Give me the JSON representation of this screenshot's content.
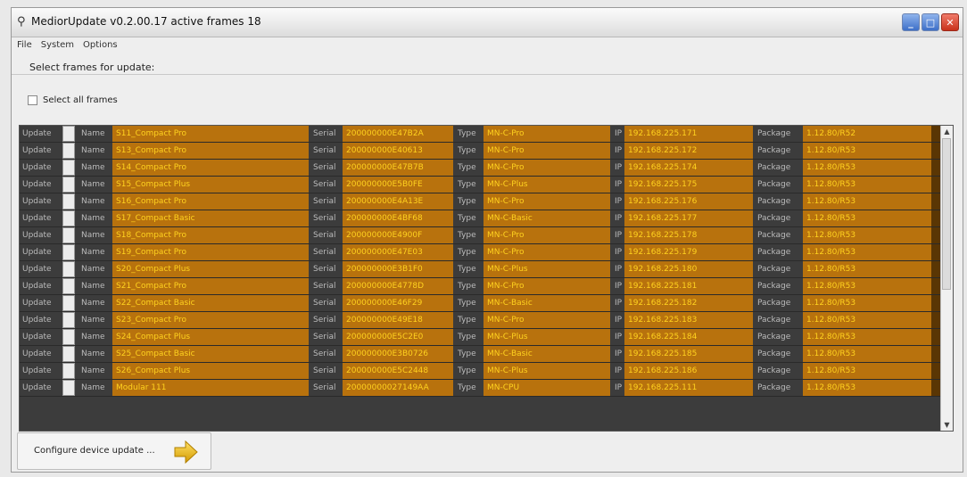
{
  "window": {
    "title": "MediorUpdate  v0.2.00.17    active frames  18",
    "app_icon": "app-icon"
  },
  "menu": [
    "File",
    "System",
    "Options"
  ],
  "section_title": "Select frames for update:",
  "select_all_label": "Select all frames",
  "row_labels": {
    "update": "Update",
    "name": "Name",
    "serial": "Serial",
    "type": "Type",
    "ip": "IP",
    "package": "Package"
  },
  "frames": [
    {
      "name": "S11_Compact Pro",
      "serial": "200000000E47B2A",
      "type": "MN-C-Pro",
      "ip": "192.168.225.171",
      "package": "1.12.80/R52"
    },
    {
      "name": "S13_Compact Pro",
      "serial": "200000000E40613",
      "type": "MN-C-Pro",
      "ip": "192.168.225.172",
      "package": "1.12.80/R53"
    },
    {
      "name": "S14_Compact Pro",
      "serial": "200000000E47B7B",
      "type": "MN-C-Pro",
      "ip": "192.168.225.174",
      "package": "1.12.80/R53"
    },
    {
      "name": "S15_Compact Plus",
      "serial": "200000000E5B0FE",
      "type": "MN-C-Plus",
      "ip": "192.168.225.175",
      "package": "1.12.80/R53"
    },
    {
      "name": "S16_Compact Pro",
      "serial": "200000000E4A13E",
      "type": "MN-C-Pro",
      "ip": "192.168.225.176",
      "package": "1.12.80/R53"
    },
    {
      "name": "S17_Compact Basic",
      "serial": "200000000E4BF68",
      "type": "MN-C-Basic",
      "ip": "192.168.225.177",
      "package": "1.12.80/R53"
    },
    {
      "name": "S18_Compact Pro",
      "serial": "200000000E4900F",
      "type": "MN-C-Pro",
      "ip": "192.168.225.178",
      "package": "1.12.80/R53"
    },
    {
      "name": "S19_Compact Pro",
      "serial": "200000000E47E03",
      "type": "MN-C-Pro",
      "ip": "192.168.225.179",
      "package": "1.12.80/R53"
    },
    {
      "name": "S20_Compact Plus",
      "serial": "200000000E3B1F0",
      "type": "MN-C-Plus",
      "ip": "192.168.225.180",
      "package": "1.12.80/R53"
    },
    {
      "name": "S21_Compact Pro",
      "serial": "200000000E4778D",
      "type": "MN-C-Pro",
      "ip": "192.168.225.181",
      "package": "1.12.80/R53"
    },
    {
      "name": "S22_Compact Basic",
      "serial": "200000000E46F29",
      "type": "MN-C-Basic",
      "ip": "192.168.225.182",
      "package": "1.12.80/R53"
    },
    {
      "name": "S23_Compact Pro",
      "serial": "200000000E49E18",
      "type": "MN-C-Pro",
      "ip": "192.168.225.183",
      "package": "1.12.80/R53"
    },
    {
      "name": "S24_Compact Plus",
      "serial": "200000000E5C2E0",
      "type": "MN-C-Plus",
      "ip": "192.168.225.184",
      "package": "1.12.80/R53"
    },
    {
      "name": "S25_Compact Basic",
      "serial": "200000000E3B0726",
      "type": "MN-C-Basic",
      "ip": "192.168.225.185",
      "package": "1.12.80/R53"
    },
    {
      "name": "S26_Compact Plus",
      "serial": "200000000E5C2448",
      "type": "MN-C-Plus",
      "ip": "192.168.225.186",
      "package": "1.12.80/R53"
    },
    {
      "name": "Modular 111",
      "serial": "20000000027149AA",
      "type": "MN-CPU",
      "ip": "192.168.225.111",
      "package": "1.12.80/R53"
    }
  ],
  "configure_button": "Configure device update ...",
  "colors": {
    "row_value_bg": "#b8720d",
    "row_value_text": "#ffd21f",
    "row_bg": "#3c3c3c"
  }
}
